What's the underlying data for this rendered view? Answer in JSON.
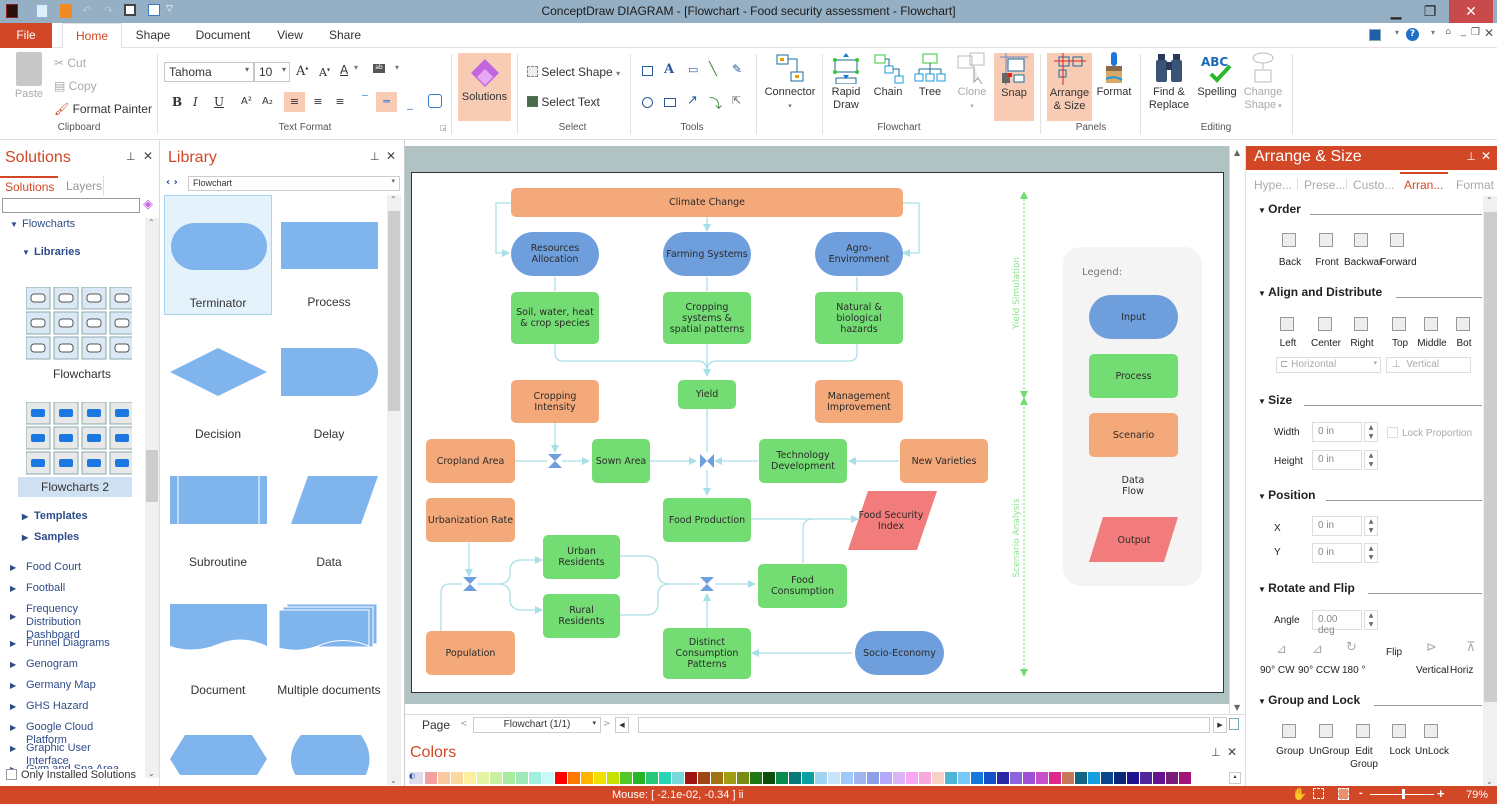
{
  "app": {
    "title": "ConceptDraw DIAGRAM - [Flowchart - Food security assessment - Flowchart]"
  },
  "tabs": [
    "File",
    "Home",
    "Shape",
    "Document",
    "View",
    "Share"
  ],
  "ribbon": {
    "clipboard": {
      "paste": "Paste",
      "cut": "Cut",
      "copy": "Copy",
      "format_painter": "Format Painter",
      "label": "Clipboard"
    },
    "text_format": {
      "font": "Tahoma",
      "size": "10",
      "label": "Text Format",
      "bold": "B",
      "italic": "I",
      "underline": "U"
    },
    "solutions": "Solutions",
    "select": {
      "select_shape": "Select Shape",
      "select_text": "Select Text",
      "label": "Select"
    },
    "tools": {
      "label": "Tools"
    },
    "flowchart": {
      "connector": "Connector",
      "rapid_draw_1": "Rapid",
      "rapid_draw_2": "Draw",
      "chain": "Chain",
      "tree": "Tree",
      "clone": "Clone",
      "snap": "Snap",
      "label": "Flowchart"
    },
    "panels": {
      "arrange_1": "Arrange",
      "arrange_2": "& Size",
      "format": "Format",
      "label": "Panels"
    },
    "editing": {
      "find_1": "Find &",
      "find_2": "Replace",
      "spelling": "Spelling",
      "change_1": "Change",
      "change_2": "Shape",
      "label": "Editing"
    }
  },
  "solutions_panel": {
    "title": "Solutions",
    "tabs": [
      "Solutions",
      "Layers"
    ],
    "search_value": "",
    "tree": {
      "flowcharts": "Flowcharts",
      "libraries": "Libraries",
      "lib1": "Flowcharts",
      "lib2": "Flowcharts 2",
      "templates": "Templates",
      "samples": "Samples"
    },
    "items": [
      "Food Court",
      "Football",
      "Frequency Distribution Dashboard",
      "Funnel Diagrams",
      "Genogram",
      "Germany Map",
      "GHS Hazard",
      "Google Cloud Platform",
      "Graphic User Interface",
      "Gym and Spa Area"
    ],
    "only_installed": "Only Installed Solutions"
  },
  "library_panel": {
    "title": "Library",
    "selected": "Flowchart",
    "shapes": [
      "Terminator",
      "Process",
      "Decision",
      "Delay",
      "Subroutine",
      "Data",
      "Document",
      "Multiple documents"
    ]
  },
  "diagram": {
    "nodes": {
      "climate_change": "Climate Change",
      "resources_allocation": "Resources Allocation",
      "farming_systems": "Farming Systems",
      "agro_environment": "Agro-Environment",
      "soil": "Soil, water, heat & crop species",
      "cropping_systems": "Cropping systems & spatial patterns",
      "natural_hazards": "Natural & biological hazards",
      "cropping_intensity": "Cropping Intensity",
      "yield": "Yield",
      "management_improvement": "Management Improvement",
      "cropland_area": "Cropland Area",
      "sown_area": "Sown Area",
      "technology_development": "Technology Development",
      "new_varieties": "New Varieties",
      "urbanization_rate": "Urbanization Rate",
      "food_production": "Food Production",
      "food_security_index": "Food Security Index",
      "urban_residents": "Urban Residents",
      "rural_residents": "Rural Residents",
      "food_consumption": "Food Consumption",
      "population": "Population",
      "distinct_consumption": "Distinct Consumption Patterns",
      "socio_economy": "Socio-Economy"
    },
    "side_labels": {
      "yield_simulation": "Yield Simulation",
      "scenario_analysis": "Scenario Analysis"
    },
    "legend": {
      "title": "Legend:",
      "input": "Input",
      "process": "Process",
      "scenario": "Scenario",
      "data_flow": "Data Flow",
      "output": "Output"
    },
    "colors": {
      "input": "#6f9edc",
      "process": "#73dd73",
      "scenario": "#f4a97a",
      "output": "#f27b7b",
      "flow": "#a9dfe6"
    }
  },
  "page_bar": {
    "label": "Page",
    "page_select": "Flowchart (1/1)"
  },
  "colors_panel": {
    "title": "Colors",
    "swatches": [
      "#f4a0a0",
      "#fcc8a0",
      "#fcd8a0",
      "#fcf0a0",
      "#e4f4a0",
      "#c8f0a0",
      "#a8eca0",
      "#a0e8b8",
      "#a0f0e0",
      "#c8f8f8",
      "#ff0000",
      "#ff7800",
      "#ffb400",
      "#f0e000",
      "#c8e000",
      "#50c828",
      "#28b428",
      "#28c878",
      "#28d4b4",
      "#78d8dc",
      "#a01414",
      "#a04614",
      "#a07014",
      "#a09c14",
      "#788c14",
      "#1e7814",
      "#0a500a",
      "#0a8c50",
      "#0a7878",
      "#0aa0a0",
      "#a0d4f0",
      "#c8e4f8",
      "#a0c8f8",
      "#a0b4f0",
      "#8ca0e8",
      "#b4a8f8",
      "#dcb4f8",
      "#f8a8f0",
      "#f8a8dc",
      "#f8d0c8",
      "#50b4d4",
      "#78c8f8",
      "#1478dc",
      "#1450c8",
      "#2828a0",
      "#8c64dc",
      "#a050d4",
      "#c850c8",
      "#e0288c",
      "#c8785a",
      "#146482",
      "#14a0e0",
      "#0a468c",
      "#0a2878",
      "#1e1490",
      "#50289c",
      "#64148c",
      "#781e78",
      "#a01478"
    ]
  },
  "arrange_panel": {
    "title": "Arrange & Size",
    "tabs": [
      "Hype...",
      "Prese...",
      "Custo...",
      "Arran...",
      "Format"
    ],
    "order": {
      "title": "Order",
      "buttons": [
        "Back",
        "Front",
        "Backwar",
        "Forward"
      ]
    },
    "align": {
      "title": "Align and Distribute",
      "buttons": [
        "Left",
        "Center",
        "Right",
        "Top",
        "Middle",
        "Bot"
      ],
      "horizontal": "Horizontal",
      "vertical": "Vertical"
    },
    "size": {
      "title": "Size",
      "width_label": "Width",
      "width": "0 in",
      "height_label": "Height",
      "height": "0 in",
      "lock": "Lock Proportion"
    },
    "position": {
      "title": "Position",
      "x_label": "X",
      "x": "0 in",
      "y_label": "Y",
      "y": "0 in"
    },
    "rotate": {
      "title": "Rotate and Flip",
      "angle_label": "Angle",
      "angle": "0.00 deg",
      "buttons": [
        "90° CW",
        "90° CCW",
        "180 °"
      ],
      "flip": "Flip",
      "flip_buttons": [
        "Vertical",
        "Horiz"
      ]
    },
    "group": {
      "title": "Group and Lock",
      "buttons": [
        "Group",
        "UnGroup",
        "Edit Group",
        "Lock",
        "UnLock"
      ]
    }
  },
  "status": {
    "mouse": "Mouse: [ -2.1e-02, -0.34 ] ii",
    "zoom": "79%",
    "zoom_fraction": 0.5
  }
}
